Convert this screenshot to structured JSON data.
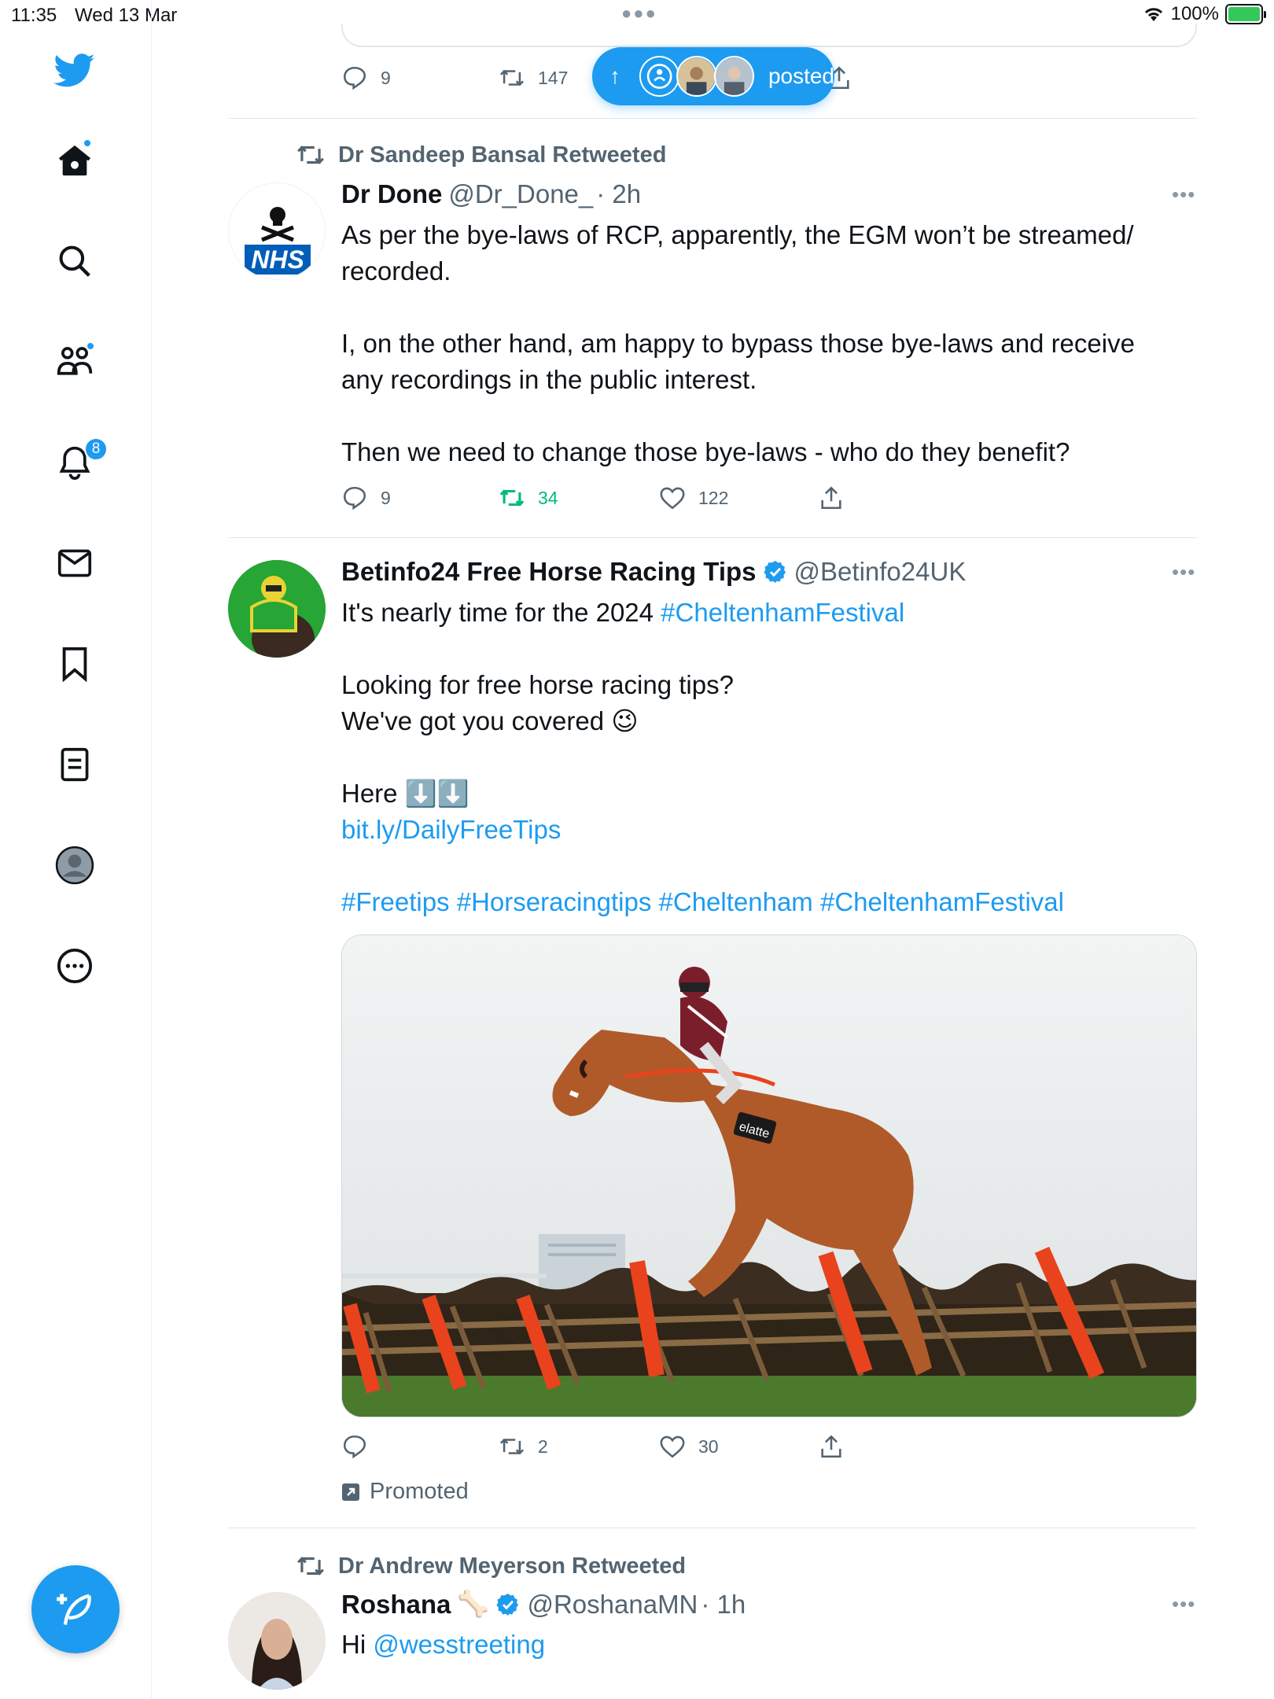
{
  "status_bar": {
    "time": "11:35",
    "date": "Wed 13 Mar",
    "battery": "100%"
  },
  "sidebar": {
    "notification_count": "8"
  },
  "top_tweet": {
    "replies": "9",
    "retweets": "147"
  },
  "posted_pill": {
    "label": "posted"
  },
  "tweet1": {
    "retweeted_by": "Dr Sandeep Bansal Retweeted",
    "name": "Dr Done",
    "handle": "@Dr_Done_",
    "time": "· 2h",
    "avatar_text": "NHS",
    "lines": [
      "As per the bye-laws of RCP, apparently, the EGM won’t be streamed/",
      "recorded.",
      "",
      "I, on the other hand, am happy to bypass those bye-laws and receive",
      "any recordings in the public interest.",
      "",
      "Then we need to change those bye-laws - who do they benefit?"
    ],
    "replies": "9",
    "retweets": "34",
    "likes": "122"
  },
  "tweet2": {
    "name": "Betinfo24 Free Horse Racing Tips",
    "handle": "@Betinfo24UK",
    "line1_prefix": "It's nearly time for the 2024 ",
    "line1_hashtag": "#CheltenhamFestival",
    "line2": "Looking for free horse racing tips?",
    "line3": "We've got you covered 😉",
    "line4": "Here ⬇️⬇️",
    "link": "bit.ly/DailyFreeTips",
    "hashtags": "#Freetips #Horseracingtips #Cheltenham #CheltenhamFestival",
    "saddle_cloth_text": "elatte",
    "replies": "",
    "retweets": "2",
    "likes": "30",
    "promoted": "Promoted"
  },
  "tweet3": {
    "retweeted_by": "Dr Andrew Meyerson Retweeted",
    "name": "Roshana",
    "name_emoji": "🦴",
    "handle": "@RoshanaMN",
    "time": "· 1h",
    "text_prefix": "Hi ",
    "mention": "@wesstreeting"
  },
  "colors": {
    "accent": "#1d9bf0",
    "retweet_green": "#00ba7c",
    "muted": "#536471"
  }
}
